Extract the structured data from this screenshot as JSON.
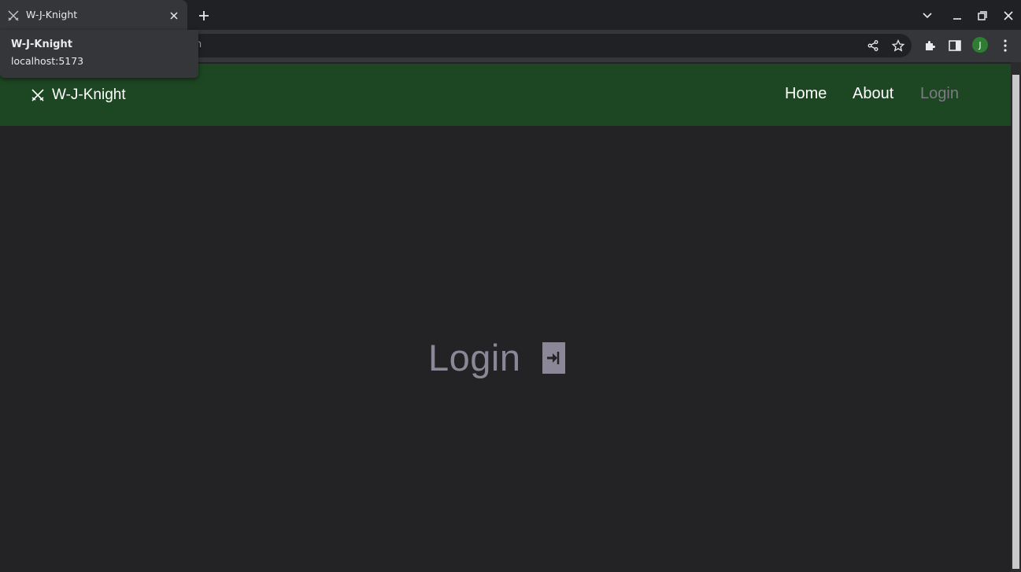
{
  "browser": {
    "tab": {
      "title": "W-J-Knight",
      "favicon": "crossed-swords-icon"
    },
    "hovercard": {
      "title": "W-J-Knight",
      "url": "localhost:5173"
    },
    "omnibox": {
      "text": "n"
    },
    "profile": {
      "initial": "J"
    }
  },
  "site": {
    "brand": "W-J-Knight",
    "nav": {
      "home": "Home",
      "about": "About",
      "login": "Login"
    },
    "hero": {
      "title": "Login"
    }
  },
  "colors": {
    "navbar": "#1c4722",
    "page_bg": "#232326",
    "muted_text": "#8b8797"
  }
}
